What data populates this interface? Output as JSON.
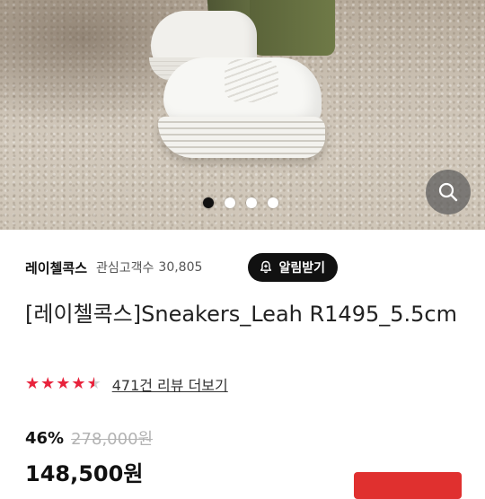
{
  "gallery": {
    "image_alt": "",
    "dots": [
      true,
      false,
      false,
      false
    ],
    "zoom_icon": "search-icon"
  },
  "seller": {
    "name": "레이첼콕스",
    "followers_label": "관심고객수",
    "followers_count": "30,805",
    "alarm_label": "알림받기",
    "alarm_icon": "bell-plus-icon"
  },
  "product": {
    "title": "[레이첼콕스]Sneakers_Leah R1495_5.5cm",
    "rating": 4.5,
    "review_link": "471건 리뷰 더보기",
    "discount": "46%",
    "original_price": "278,000원",
    "price": "148,500원"
  },
  "colors": {
    "accent": "#e0302f",
    "star": "#e8233c",
    "alarm_bg": "#111111"
  }
}
